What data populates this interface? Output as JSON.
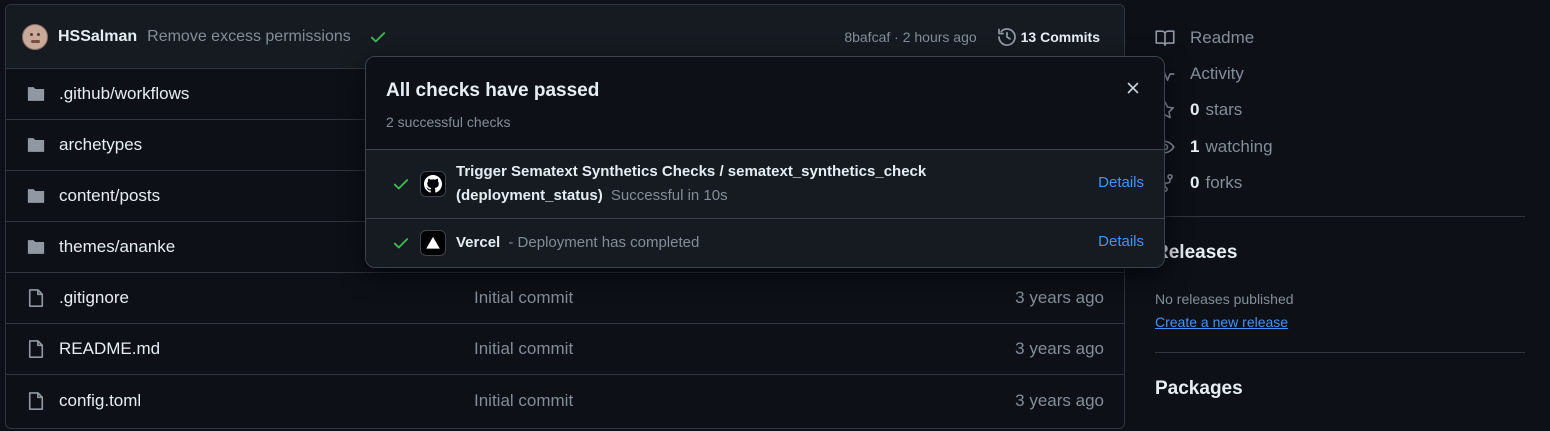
{
  "commit": {
    "author": "HSSalman",
    "message": "Remove excess permissions",
    "sha_time": "8bafcaf · 2 hours ago",
    "commits_count": "13 Commits"
  },
  "files": [
    {
      "name": ".github/workflows",
      "type": "folder",
      "message": "",
      "date": ""
    },
    {
      "name": "archetypes",
      "type": "folder",
      "message": "",
      "date": ""
    },
    {
      "name": "content/posts",
      "type": "folder",
      "message": "",
      "date": ""
    },
    {
      "name": "themes/ananke",
      "type": "folder",
      "message": "",
      "date": ""
    },
    {
      "name": ".gitignore",
      "type": "file",
      "message": "Initial commit",
      "date": "3 years ago"
    },
    {
      "name": "README.md",
      "type": "file",
      "message": "Initial commit",
      "date": "3 years ago"
    },
    {
      "name": "config.toml",
      "type": "file",
      "message": "Initial commit",
      "date": "3 years ago"
    }
  ],
  "sidebar": {
    "readme": "Readme",
    "activity": "Activity",
    "stars_count": "0",
    "stars_label": "stars",
    "watching_count": "1",
    "watching_label": "watching",
    "forks_count": "0",
    "forks_label": "forks",
    "releases_heading": "Releases",
    "no_releases": "No releases published",
    "create_release": "Create a new release",
    "packages_heading": "Packages"
  },
  "popover": {
    "title": "All checks have passed",
    "subtitle": "2 successful checks",
    "checks": [
      {
        "name_line1": "Trigger Sematext Synthetics Checks / sematext_synthetics_check",
        "name_line2": "(deployment_status)",
        "status": "Successful in 10s",
        "details": "Details",
        "app_icon": "github-icon"
      },
      {
        "name": "Vercel",
        "status": "- Deployment has completed",
        "details": "Details",
        "app_icon": "vercel-icon"
      }
    ]
  },
  "colors": {
    "success": "#3fb950",
    "link": "#4493f8",
    "muted": "#848d97",
    "border": "#30363d"
  }
}
